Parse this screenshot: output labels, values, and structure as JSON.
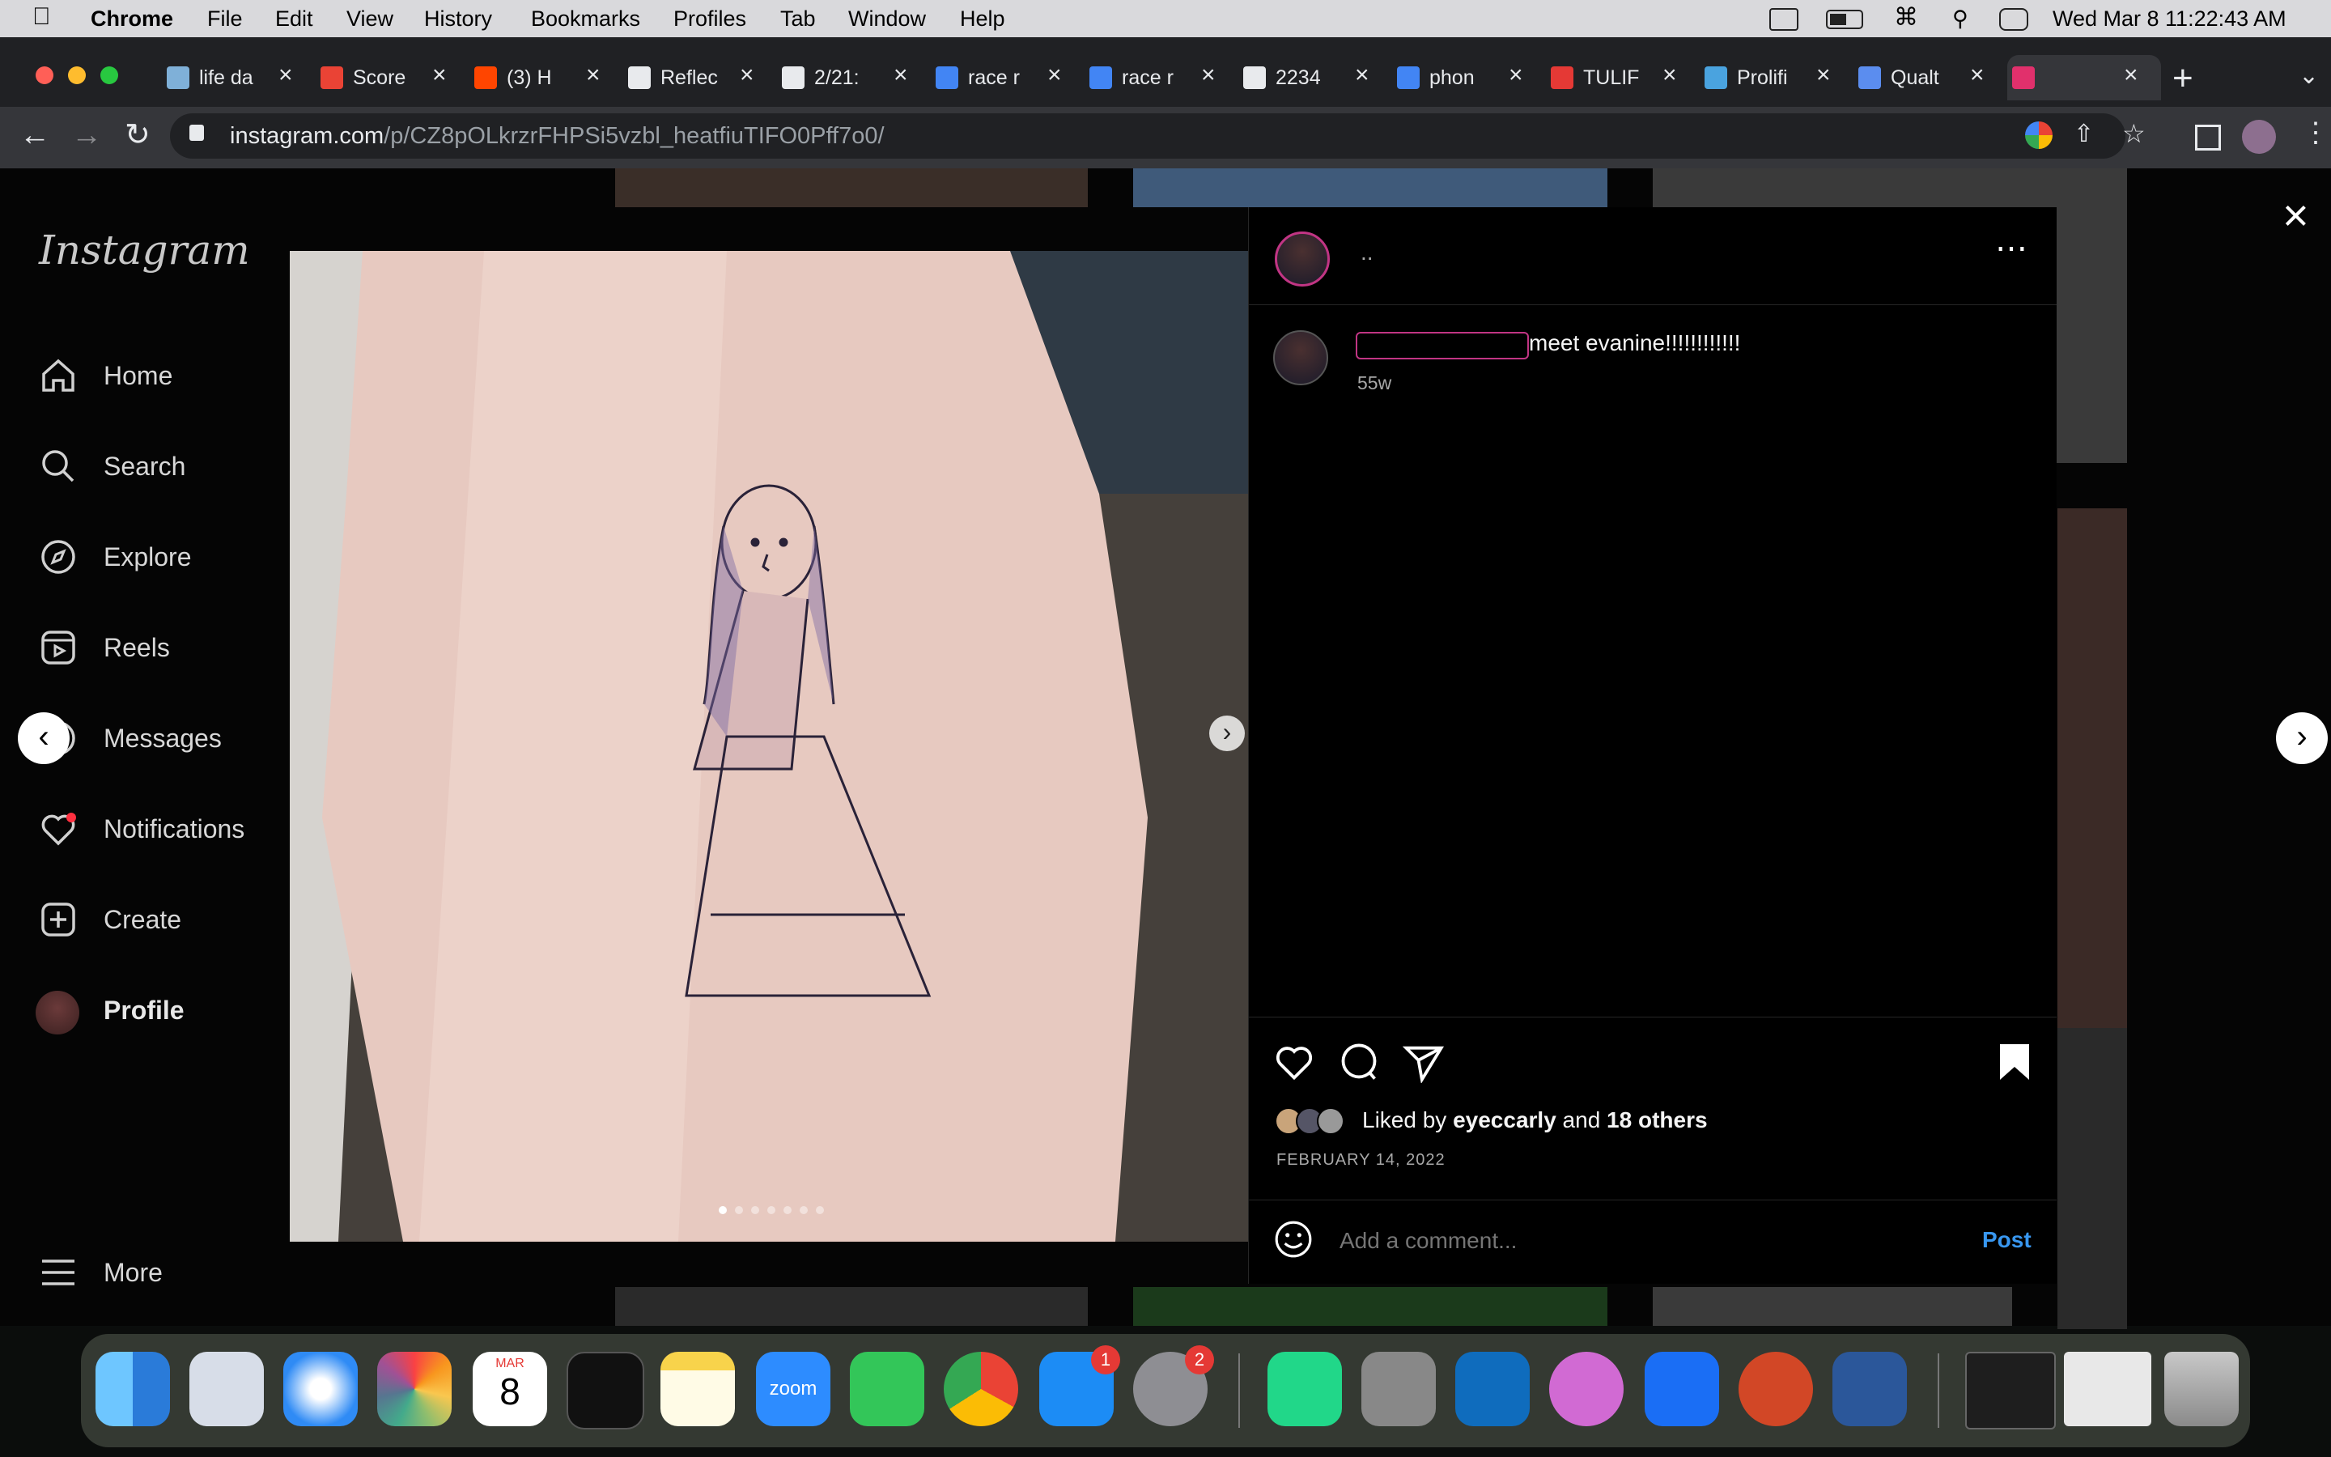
{
  "menubar": {
    "app": "Chrome",
    "menus": [
      "File",
      "Edit",
      "View",
      "History",
      "Bookmarks",
      "Profiles",
      "Tab",
      "Window",
      "Help"
    ],
    "clock": "Wed Mar 8  11:22:43 AM"
  },
  "tabs": [
    {
      "label": "life da",
      "color": "#7fb0d8"
    },
    {
      "label": "Score",
      "color": "#ea4335"
    },
    {
      "label": "(3) H",
      "color": "#ff4500"
    },
    {
      "label": "Reflec",
      "color": "#e8eaed"
    },
    {
      "label": "2/21:",
      "color": "#e8eaed"
    },
    {
      "label": "race r",
      "color": "#4285f4"
    },
    {
      "label": "race r",
      "color": "#4285f4"
    },
    {
      "label": "2234",
      "color": "#e8eaed"
    },
    {
      "label": "phon",
      "color": "#4285f4"
    },
    {
      "label": "TULIF",
      "color": "#e53935"
    },
    {
      "label": "Prolifi",
      "color": "#4aa3df"
    },
    {
      "label": "Qualt",
      "color": "#5b8def"
    },
    {
      "label": "",
      "color": "#e1306c"
    }
  ],
  "url": {
    "host": "instagram.com",
    "path": "/p/CZ8pOLkrzrFHPSi5vzbl_heatfiuTIFO0Pff7o0/"
  },
  "sidebar": {
    "logo": "Instagram",
    "items": [
      "Home",
      "Search",
      "Explore",
      "Reels",
      "Messages",
      "Notifications",
      "Create",
      "Profile"
    ],
    "more": "More"
  },
  "post": {
    "header_user": "..",
    "caption": "meet evanine!!!!!!!!!!!!",
    "caption_age": "55w",
    "liked_by_prefix": "Liked by ",
    "liked_by_user": "eyeccarly",
    "liked_by_and": " and ",
    "liked_by_others": "18 others",
    "date": "FEBRUARY 14, 2022",
    "comment_placeholder": "Add a comment...",
    "post_button": "Post",
    "carousel_count": 7,
    "carousel_active": 0
  },
  "dock": {
    "calendar_month": "MAR",
    "calendar_day": "8",
    "zoom_label": "zoom",
    "appstore_badge": "1",
    "settings_badge": "2"
  }
}
